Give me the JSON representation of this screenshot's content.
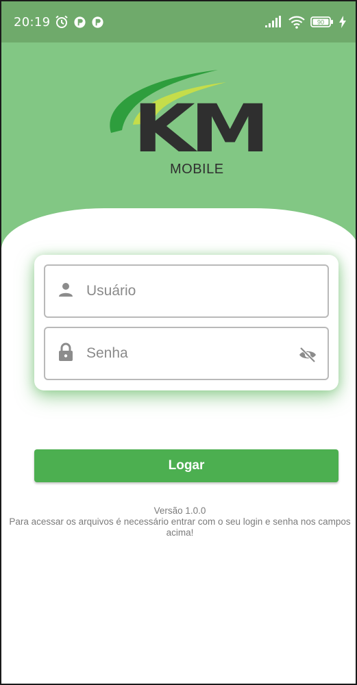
{
  "status_bar": {
    "time": "20:19",
    "battery": "90",
    "icons": [
      "alarm-icon",
      "notification-icon",
      "notification-icon",
      "signal-icon",
      "wifi-icon",
      "battery-icon",
      "charging-icon"
    ]
  },
  "logo": {
    "brand": "KM",
    "subtitle": "MOBILE"
  },
  "login_form": {
    "username_placeholder": "Usuário",
    "password_placeholder": "Senha",
    "username_icon": "user-icon",
    "password_icon": "lock-icon",
    "visibility_icon": "eye-off-icon"
  },
  "login_button": {
    "label": "Logar"
  },
  "footer": {
    "version": "Versão 1.0.0",
    "message": "Para acessar os arquivos é necessário entrar com o seu login e senha nos campos acima!"
  },
  "colors": {
    "status_bar": "#6faa6b",
    "header": "#82c784",
    "button": "#4caf50",
    "logo_arc_dark": "#2e9e3d",
    "logo_arc_light": "#c5dd4a",
    "logo_text": "#2f2f2f"
  }
}
